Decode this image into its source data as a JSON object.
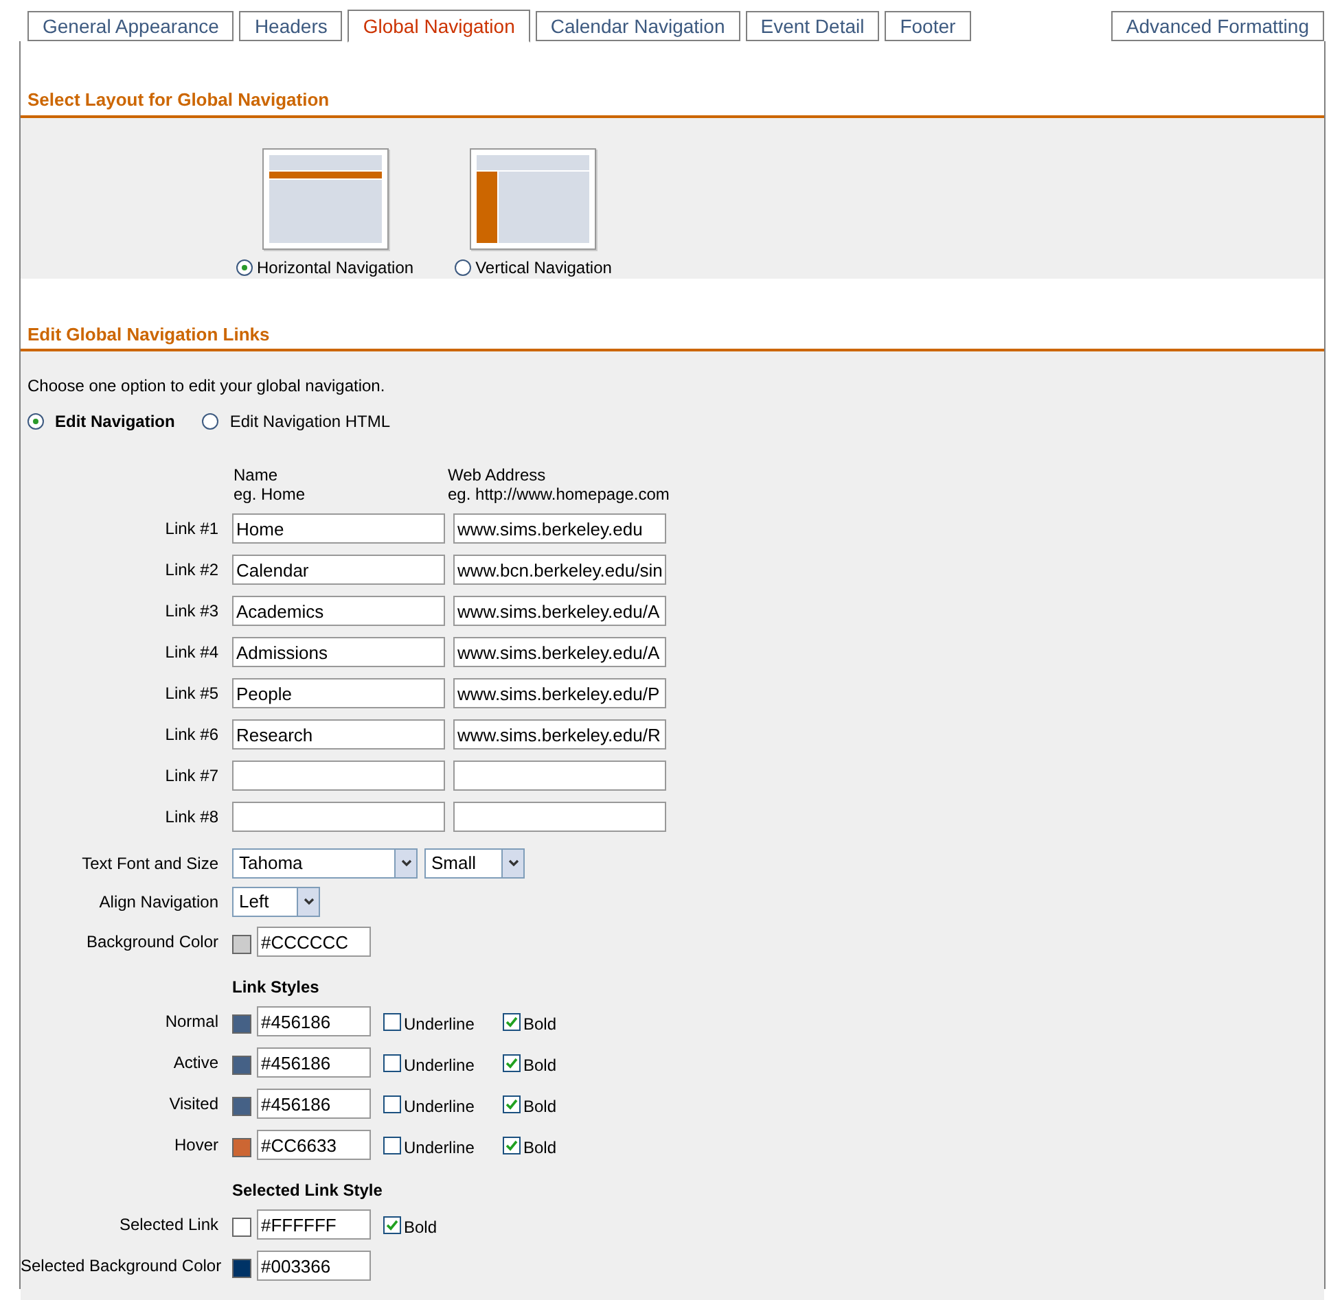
{
  "tabs": [
    {
      "label": "General Appearance",
      "selected": false
    },
    {
      "label": "Headers",
      "selected": false
    },
    {
      "label": "Global Navigation",
      "selected": true
    },
    {
      "label": "Calendar Navigation",
      "selected": false
    },
    {
      "label": "Event Detail",
      "selected": false
    },
    {
      "label": "Footer",
      "selected": false
    },
    {
      "label": "Advanced Formatting",
      "selected": false
    }
  ],
  "layout_section": {
    "title": "Select Layout for Global Navigation",
    "options": [
      {
        "kind": "horizontal",
        "label": "Horizontal Navigation",
        "selected": true
      },
      {
        "kind": "vertical",
        "label": "Vertical Navigation",
        "selected": false
      }
    ]
  },
  "links_section": {
    "title": "Edit Global Navigation Links",
    "instruction": "Choose one option to edit your global navigation.",
    "modes": [
      {
        "label": "Edit Navigation",
        "selected": true
      },
      {
        "label": "Edit Navigation HTML",
        "selected": false
      }
    ],
    "name_header": "Name",
    "name_example": "eg. Home",
    "address_header": "Web Address",
    "address_example": "eg. http://www.homepage.com",
    "links": [
      {
        "label": "Link #1",
        "name": "Home",
        "address": "www.sims.berkeley.edu"
      },
      {
        "label": "Link #2",
        "name": "Calendar",
        "address": "www.bcn.berkeley.edu/sin"
      },
      {
        "label": "Link #3",
        "name": "Academics",
        "address": "www.sims.berkeley.edu/A"
      },
      {
        "label": "Link #4",
        "name": "Admissions",
        "address": "www.sims.berkeley.edu/A"
      },
      {
        "label": "Link #5",
        "name": "People",
        "address": "www.sims.berkeley.edu/P"
      },
      {
        "label": "Link #6",
        "name": "Research",
        "address": "www.sims.berkeley.edu/R"
      },
      {
        "label": "Link #7"
      },
      {
        "label": "Link #8"
      }
    ],
    "font": {
      "label": "Text Font and Size",
      "font_value": "Tahoma",
      "size_value": "Small"
    },
    "align": {
      "label": "Align Navigation",
      "value": "Left"
    },
    "background": {
      "label": "Background Color",
      "color": "#cccccc",
      "value": "#CCCCCC"
    },
    "link_styles": {
      "title": "Link Styles",
      "rows": [
        {
          "label": "Normal",
          "color": "#456186",
          "value": "#456186",
          "underline_label": "Underline",
          "underline_checked": false,
          "bold_label": "Bold",
          "bold_checked": true
        },
        {
          "label": "Active",
          "color": "#456186",
          "value": "#456186",
          "underline_label": "Underline",
          "underline_checked": false,
          "bold_label": "Bold",
          "bold_checked": true
        },
        {
          "label": "Visited",
          "color": "#456186",
          "value": "#456186",
          "underline_label": "Underline",
          "underline_checked": false,
          "bold_label": "Bold",
          "bold_checked": true
        },
        {
          "label": "Hover",
          "color": "#cc6633",
          "value": "#CC6633",
          "underline_label": "Underline",
          "underline_checked": false,
          "bold_label": "Bold",
          "bold_checked": true
        }
      ]
    },
    "selected_style": {
      "title": "Selected Link Style",
      "rows": [
        {
          "label": "Selected Link",
          "color": "#ffffff",
          "value": "#FFFFFF",
          "bold_label": "Bold",
          "bold_checked": true
        },
        {
          "label": "Selected Background Color",
          "color": "#003366",
          "value": "#003366"
        }
      ]
    }
  }
}
